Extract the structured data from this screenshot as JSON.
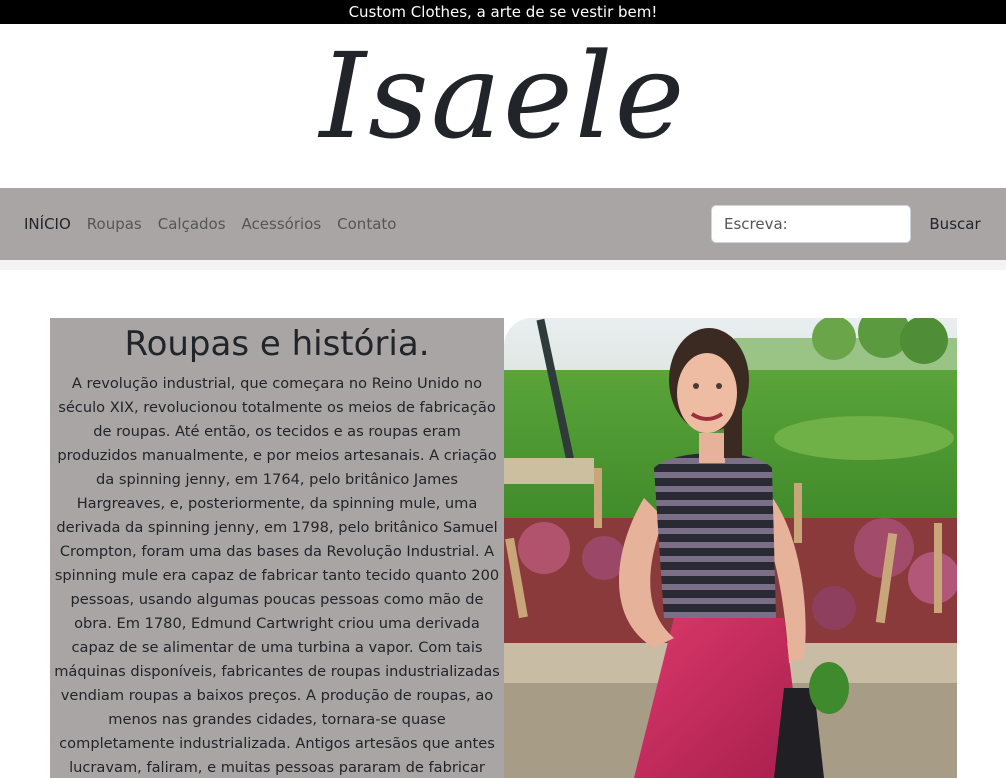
{
  "topbar": {
    "text": "Custom Clothes, a arte de se vestir bem!"
  },
  "logo": {
    "text": "Isaele"
  },
  "nav": {
    "items": [
      "INÍCIO",
      "Roupas",
      "Calçados",
      "Acessórios",
      "Contato"
    ],
    "active_index": 0
  },
  "search": {
    "placeholder": "Escreva:",
    "button_label": "Buscar"
  },
  "article": {
    "title": "Roupas e história.",
    "body": "A revolução industrial, que começara no Reino Unido no século XIX, revolucionou totalmente os meios de fabricação de roupas. Até então, os tecidos e as roupas eram produzidos manualmente, e por meios artesanais. A criação da spinning jenny, em 1764, pelo britânico James Hargreaves, e, posteriormente, da spinning mule, uma derivada da spinning jenny, em 1798, pelo britânico Samuel Crompton, foram uma das bases da Revolução Industrial. A spinning mule era capaz de fabricar tanto tecido quanto 200 pessoas, usando algumas poucas pessoas como mão de obra. Em 1780, Edmund Cartwright criou uma derivada capaz de se alimentar de uma turbina a vapor. Com tais máquinas disponíveis, fabricantes de roupas industrializadas vendiam roupas a baixos preços. A produção de roupas, ao menos nas grandes cidades, tornara-se quase completamente industrializada. Antigos artesãos que antes lucravam, faliram, e muitas pessoas pararam de fabricar suas roupas em casa."
  },
  "colors": {
    "topbar": "#000000",
    "navbar": "#aaa5a5",
    "panel": "#aaa5a5"
  }
}
